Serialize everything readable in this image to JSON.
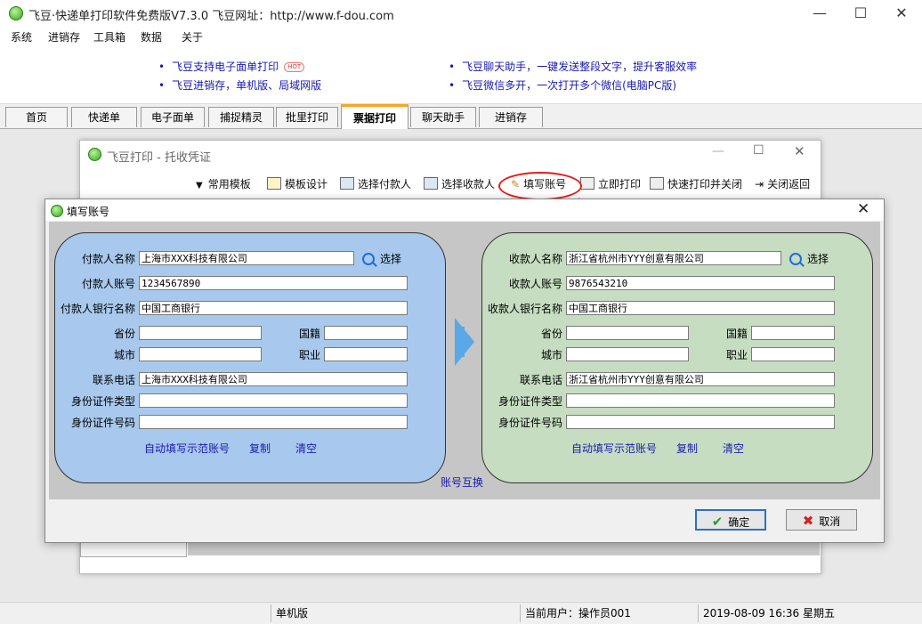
{
  "window": {
    "title": "飞豆·快递单打印软件免费版V7.3.0  飞豆网址：http://www.f-dou.com",
    "minimize": "—",
    "maximize": "☐",
    "close": "✕"
  },
  "menu": [
    "系统",
    "进销存",
    "工具箱",
    "数据",
    "关于"
  ],
  "ads": {
    "left1": "飞豆支持电子面单打印",
    "hot": "HOT",
    "left2": "飞豆进销存，单机版、局域网版",
    "right1": "飞豆聊天助手，一键发送整段文字，提升客服效率",
    "right2": "飞豆微信多开，一次打开多个微信(电脑PC版)"
  },
  "tabs": [
    "首页",
    "快递单",
    "电子面单",
    "捕捉精灵",
    "批里打印",
    "票据打印",
    "聊天助手",
    "进销存"
  ],
  "inner": {
    "title": "飞豆打印 - 托收凭证",
    "toolbar": [
      "常用模板",
      "模板设计",
      "选择付款人",
      "选择收款人",
      "填写账号",
      "立即打印",
      "快速打印并关闭",
      "关闭返回"
    ]
  },
  "dialog": {
    "title": "填写账号",
    "select_label": "选择",
    "payer": {
      "name_label": "付款人名称",
      "name": "上海市XXX科技有限公司",
      "account_label": "付款人账号",
      "account": "1234567890",
      "bank_label": "付款人银行名称",
      "bank": "中国工商银行",
      "province_label": "省份",
      "country_label": "国籍",
      "city_label": "城市",
      "job_label": "职业",
      "phone_label": "联系电话",
      "phone": "上海市XXX科技有限公司",
      "idtype_label": "身份证件类型",
      "idno_label": "身份证件号码"
    },
    "payee": {
      "name_label": "收款人名称",
      "name": "浙江省杭州市YYY创意有限公司",
      "account_label": "收款人账号",
      "account": "9876543210",
      "bank_label": "收款人银行名称",
      "bank": "中国工商银行",
      "province_label": "省份",
      "country_label": "国籍",
      "city_label": "城市",
      "job_label": "职业",
      "phone_label": "联系电话",
      "phone": "浙江省杭州市YYY创意有限公司",
      "idtype_label": "身份证件类型",
      "idno_label": "身份证件号码"
    },
    "links": {
      "autofill": "自动填写示范账号",
      "copy": "复制",
      "clear": "清空",
      "swap": "账号互换"
    },
    "ok": "确定",
    "cancel": "取消"
  },
  "status": {
    "edition": "单机版",
    "user": "当前用户：操作员001",
    "datetime": "2019-08-09 16:36 星期五"
  },
  "colors": {
    "payer_panel": "#a8c9ed",
    "payee_panel": "#c6ddc1",
    "link": "#1a1ab0",
    "highlight": "#e31b1b"
  }
}
